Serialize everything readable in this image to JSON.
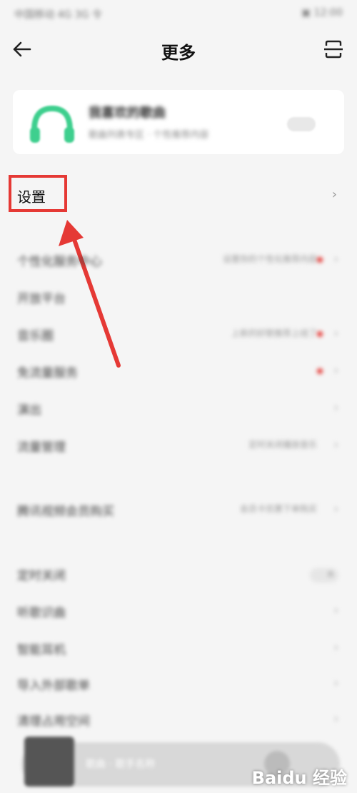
{
  "status_bar": {
    "left": "中国移动 4G 3G 令",
    "right": "▣ 12:00"
  },
  "header": {
    "title": "更多"
  },
  "promo_card": {
    "name": "我喜欢的歌曲",
    "desc": "歌曲列表专区 · 个性推荐内容",
    "toggle": "开"
  },
  "settings": {
    "label": "设置"
  },
  "rows": [
    {
      "label": "个性化服务中心",
      "value": "设置你的个性化推荐内容",
      "dot": true
    },
    {
      "label": "开放平台",
      "value": "",
      "dot": false
    },
    {
      "label": "音乐圈",
      "value": "上新的好歌推荐上线了",
      "dot": true
    },
    {
      "label": "免流量服务",
      "value": "",
      "dot": true
    },
    {
      "label": "演出",
      "value": "",
      "dot": false
    },
    {
      "label": "流量管理",
      "value": "定时关闭播放音乐",
      "dot": false
    },
    {
      "label": "腾讯视频会员购买",
      "value": "会员卡优惠下单购买",
      "dot": false
    },
    {
      "label": "定时关闭",
      "value": "",
      "dot": false,
      "switch": true,
      "switch_text": "关"
    },
    {
      "label": "听歌识曲",
      "value": "",
      "dot": false
    },
    {
      "label": "智能耳机",
      "value": "",
      "dot": false
    },
    {
      "label": "导入外部歌单",
      "value": "",
      "dot": false
    },
    {
      "label": "清理占用空间",
      "value": "",
      "dot": false
    }
  ],
  "player": {
    "text": "歌曲 · 歌手名称"
  },
  "watermark": "Baidu 经验",
  "colors": {
    "highlight": "#e53935",
    "accent_green": "#3ecf8e"
  }
}
